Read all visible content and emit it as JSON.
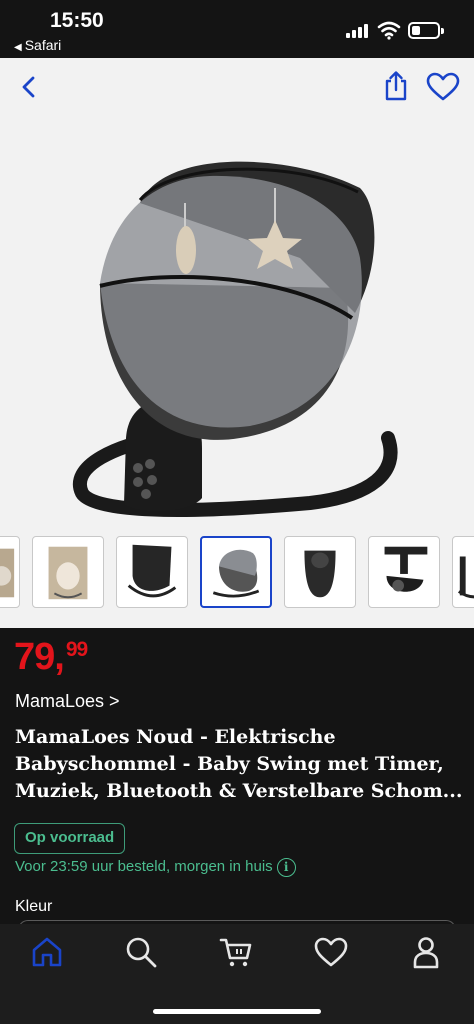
{
  "status_bar": {
    "time": "15:50",
    "back_app": "Safari"
  },
  "product": {
    "price_whole": "79,",
    "price_cents": "99",
    "brand": "MamaLoes",
    "brand_link": "MamaLoes >",
    "title_line1": "MamaLoes Noud - Elektrische",
    "title_line2": "Babyschommel - Baby Swing met Timer,",
    "title_line3": "Muziek, Bluetooth & Verstelbare Schom...",
    "stock_badge": "Op voorraad",
    "delivery": "Voor 23:59 uur besteld, morgen in huis",
    "color_label": "Kleur"
  },
  "thumbnails": {
    "count_visible": 7,
    "selected_index": 3
  },
  "tabbar": {
    "items": [
      "home",
      "search",
      "cart",
      "favorites",
      "account"
    ],
    "active": "home"
  },
  "colors": {
    "accent_blue": "#1a44c9",
    "price_red": "#e3141b",
    "stock_green": "#4bbd8f",
    "background": "#141414"
  }
}
